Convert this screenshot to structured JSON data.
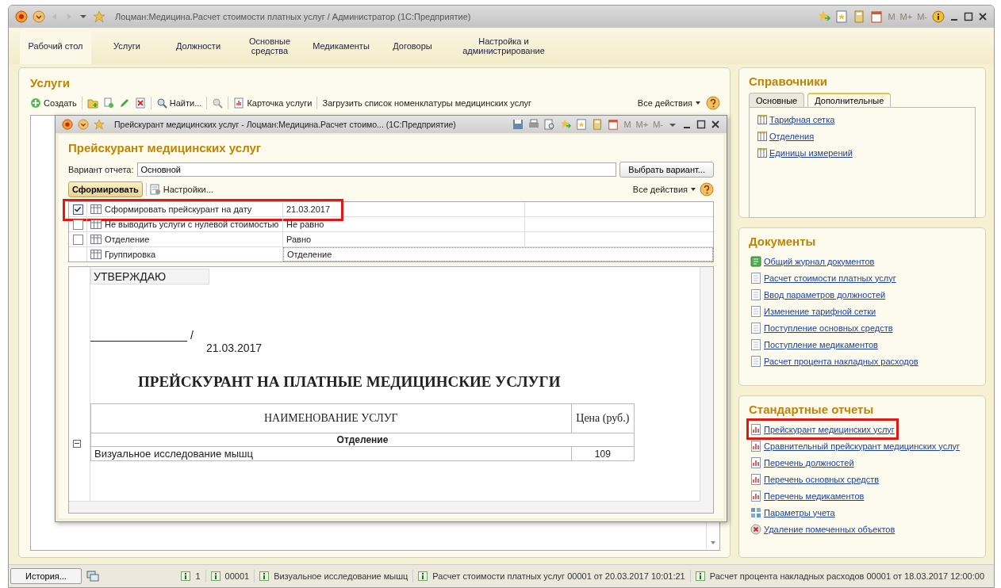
{
  "window": {
    "title": "Лоцман:Медицина.Расчет стоимости платных услуг / Администратор  (1С:Предприятие)",
    "memory_buttons": [
      "M",
      "M+",
      "M-"
    ]
  },
  "sections": [
    {
      "label": "Рабочий стол",
      "selected": true
    },
    {
      "label": "Услуги",
      "selected": false
    },
    {
      "label": "Должности",
      "selected": false
    },
    {
      "label": "Основные средства",
      "selected": false
    },
    {
      "label": "Медикаменты",
      "selected": false
    },
    {
      "label": "Договоры",
      "selected": false
    },
    {
      "label": "Настройка и администрирование",
      "selected": false
    }
  ],
  "services": {
    "title": "Услуги",
    "create": "Создать",
    "find": "Найти...",
    "card": "Карточка услуги",
    "load": "Загрузить список номенклатуры медицинских услуг",
    "all_actions": "Все действия"
  },
  "report_window": {
    "title": "Прейскурант медицинских услуг - Лоцман:Медицина.Расчет стоимо...  (1С:Предприятие)",
    "memory_buttons": [
      "M",
      "M+",
      "M-"
    ],
    "heading": "Прейскурант медицинских услуг",
    "variant_label": "Вариант отчета:",
    "variant_value": "Основной",
    "choose_variant": "Выбрать вариант...",
    "generate": "Сформировать",
    "settings": "Настройки...",
    "all_actions": "Все действия",
    "settings_rows": [
      {
        "kind": "checkbox",
        "checked": true,
        "highlighted": true,
        "label": "Сформировать прейскурант на дату",
        "value": "21.03.2017"
      },
      {
        "kind": "checkbox",
        "checked": false,
        "highlighted": false,
        "label": "Не выводить услуги с нулевой стоимостью",
        "value": "Не равно"
      },
      {
        "kind": "checkbox",
        "checked": false,
        "highlighted": false,
        "label": "Отделение",
        "value": "Равно"
      },
      {
        "kind": "plain",
        "highlighted": false,
        "label": "Группировка",
        "value": "Отделение"
      }
    ],
    "document": {
      "approve": "УТВЕРЖДАЮ",
      "signature": "/",
      "date": "21.03.2017",
      "title": "ПРЕЙСКУРАНТ НА ПЛАТНЫЕ МЕДИЦИНСКИЕ УСЛУГИ",
      "col_name": "НАИМЕНОВАНИЕ УСЛУГ",
      "col_price": "Цена (руб.)",
      "group": "Отделение",
      "rows": [
        {
          "name": "Визуальное исследование мышц",
          "price": "109"
        }
      ]
    }
  },
  "catalogs": {
    "title": "Справочники",
    "tabs": [
      {
        "label": "Основные",
        "selected": false
      },
      {
        "label": "Дополнительные",
        "selected": true
      }
    ],
    "links": [
      "Тарифная сетка",
      "Отделения",
      "Единицы измерений"
    ]
  },
  "documents": {
    "title": "Документы",
    "links": [
      {
        "kind": "journal",
        "label": "Общий журнал документов"
      },
      {
        "kind": "document",
        "label": "Расчет стоимости платных услуг"
      },
      {
        "kind": "document",
        "label": "Ввод параметров должностей"
      },
      {
        "kind": "document",
        "label": "Изменение тарифной сетки"
      },
      {
        "kind": "document",
        "label": "Поступление основных средств"
      },
      {
        "kind": "document",
        "label": "Поступление медикаментов"
      },
      {
        "kind": "document",
        "label": "Расчет процента накладных расходов"
      }
    ]
  },
  "reports": {
    "title": "Стандартные отчеты",
    "links": [
      {
        "kind": "report",
        "highlighted": true,
        "label": "Прейскурант медицинских услуг"
      },
      {
        "kind": "report",
        "highlighted": false,
        "label": "Сравнительный прейскурант медицинских услуг"
      },
      {
        "kind": "report",
        "highlighted": false,
        "label": "Перечень должностей"
      },
      {
        "kind": "report",
        "highlighted": false,
        "label": "Перечень основных средств"
      },
      {
        "kind": "report",
        "highlighted": false,
        "label": "Перечень медикаментов"
      },
      {
        "kind": "params",
        "highlighted": false,
        "label": "Параметры учета"
      },
      {
        "kind": "delete",
        "highlighted": false,
        "label": "Удаление помеченных объектов"
      }
    ]
  },
  "status_bar": {
    "history": "История...",
    "items": [
      "1",
      "00001",
      "Визуальное исследование мышц",
      "Расчет стоимости платных услуг 00001 от 20.03.2017 10:01:21",
      "Расчет процента накладных расходов 00001 от 18.03.2017 12:00:00"
    ]
  }
}
